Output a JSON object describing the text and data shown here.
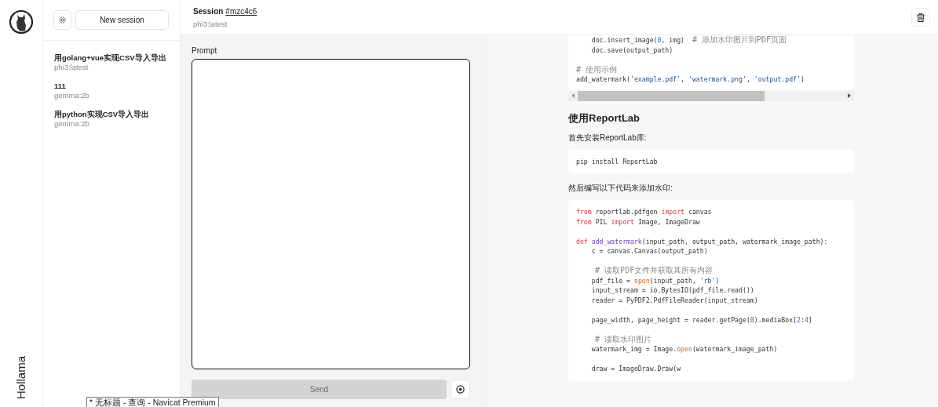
{
  "app": {
    "name": "Hollama"
  },
  "sidebar": {
    "new_session_button": "New session",
    "sessions": [
      {
        "title": "用golang+vue实现CSV导入导出",
        "model": "phi3:latest"
      },
      {
        "title": "111",
        "model": "gemma:2b"
      },
      {
        "title": "用python实现CSV导入导出",
        "model": "gemma:2b"
      }
    ]
  },
  "header": {
    "label": "Session",
    "id": "#mzc4c6",
    "model": "phi3:latest"
  },
  "prompt": {
    "label": "Prompt",
    "send_button": "Send",
    "send_disabled": true
  },
  "response": {
    "blocks": [
      {
        "kind": "code",
        "horizontal_scroll": true,
        "lines": [
          {
            "gap_before": false,
            "segments": [
              {
                "text": "    doc.insert_image(",
                "kind": "plain"
              },
              {
                "text": "0",
                "kind": "number"
              },
              {
                "text": ", img)  ",
                "kind": "plain"
              },
              {
                "text": "# 添加水印图片到PDF页面",
                "kind": "comment"
              }
            ]
          },
          {
            "gap_before": false,
            "segments": [
              {
                "text": "    doc.save(output_path)",
                "kind": "plain"
              }
            ]
          },
          {
            "gap_before": true,
            "segments": [
              {
                "text": "# 使用示例",
                "kind": "comment"
              }
            ]
          },
          {
            "gap_before": false,
            "segments": [
              {
                "text": "add_watermark(",
                "kind": "plain"
              },
              {
                "text": "'example.pdf'",
                "kind": "string"
              },
              {
                "text": ", ",
                "kind": "plain"
              },
              {
                "text": "'watermark.png'",
                "kind": "string"
              },
              {
                "text": ", ",
                "kind": "plain"
              },
              {
                "text": "'output.pdf'",
                "kind": "string"
              },
              {
                "text": ")",
                "kind": "plain"
              }
            ]
          }
        ]
      },
      {
        "kind": "heading",
        "text": "使用ReportLab"
      },
      {
        "kind": "paragraph",
        "text": "首先安装ReportLab库:"
      },
      {
        "kind": "code",
        "horizontal_scroll": false,
        "lines": [
          {
            "gap_before": false,
            "segments": [
              {
                "text": "pip install ReportLab",
                "kind": "plain"
              }
            ]
          }
        ]
      },
      {
        "kind": "paragraph",
        "text": "然后编写以下代码来添加水印:"
      },
      {
        "kind": "code",
        "horizontal_scroll": false,
        "lines": [
          {
            "gap_before": false,
            "segments": [
              {
                "text": "from",
                "kind": "keyword"
              },
              {
                "text": " reportlab.pdfgen ",
                "kind": "plain"
              },
              {
                "text": "import",
                "kind": "keyword"
              },
              {
                "text": " canvas",
                "kind": "plain"
              }
            ]
          },
          {
            "gap_before": false,
            "segments": [
              {
                "text": "from",
                "kind": "keyword"
              },
              {
                "text": " PIL ",
                "kind": "plain"
              },
              {
                "text": "import",
                "kind": "keyword"
              },
              {
                "text": " Image, ImageDraw",
                "kind": "plain"
              }
            ]
          },
          {
            "gap_before": true,
            "segments": [
              {
                "text": "def ",
                "kind": "keyword"
              },
              {
                "text": "add_watermark",
                "kind": "function"
              },
              {
                "text": "(input_path, output_path, watermark_image_path):",
                "kind": "plain"
              }
            ]
          },
          {
            "gap_before": false,
            "segments": [
              {
                "text": "    c = canvas.Canvas(output_path)",
                "kind": "plain"
              }
            ]
          },
          {
            "gap_before": true,
            "segments": [
              {
                "text": "    # 读取PDF文件并获取其所有内容",
                "kind": "comment"
              }
            ]
          },
          {
            "gap_before": false,
            "segments": [
              {
                "text": "    pdf_file = ",
                "kind": "plain"
              },
              {
                "text": "open",
                "kind": "builtin"
              },
              {
                "text": "(input_path, ",
                "kind": "plain"
              },
              {
                "text": "'rb'",
                "kind": "string"
              },
              {
                "text": ")",
                "kind": "plain"
              }
            ]
          },
          {
            "gap_before": false,
            "segments": [
              {
                "text": "    input_stream = io.BytesIO(pdf_file.read())",
                "kind": "plain"
              }
            ]
          },
          {
            "gap_before": false,
            "segments": [
              {
                "text": "    reader = PyPDF2.PdfFileReader(input_stream)",
                "kind": "plain"
              }
            ]
          },
          {
            "gap_before": true,
            "segments": [
              {
                "text": "    page_width, page_height = reader.getPage(",
                "kind": "plain"
              },
              {
                "text": "0",
                "kind": "number"
              },
              {
                "text": ").mediaBox[",
                "kind": "plain"
              },
              {
                "text": "2",
                "kind": "number"
              },
              {
                "text": ":",
                "kind": "plain"
              },
              {
                "text": "4",
                "kind": "number"
              },
              {
                "text": "]",
                "kind": "plain"
              }
            ]
          },
          {
            "gap_before": true,
            "segments": [
              {
                "text": "    # 读取水印图片",
                "kind": "comment"
              }
            ]
          },
          {
            "gap_before": false,
            "segments": [
              {
                "text": "    watermark_img = Image.",
                "kind": "plain"
              },
              {
                "text": "open",
                "kind": "builtin"
              },
              {
                "text": "(watermark_image_path)",
                "kind": "plain"
              }
            ]
          },
          {
            "gap_before": true,
            "segments": [
              {
                "text": "    draw = ImageDraw.Draw(w",
                "kind": "plain"
              }
            ]
          }
        ]
      }
    ]
  },
  "tooltip": {
    "text": "* 无标题 - 查询 - Navicat Premium"
  }
}
